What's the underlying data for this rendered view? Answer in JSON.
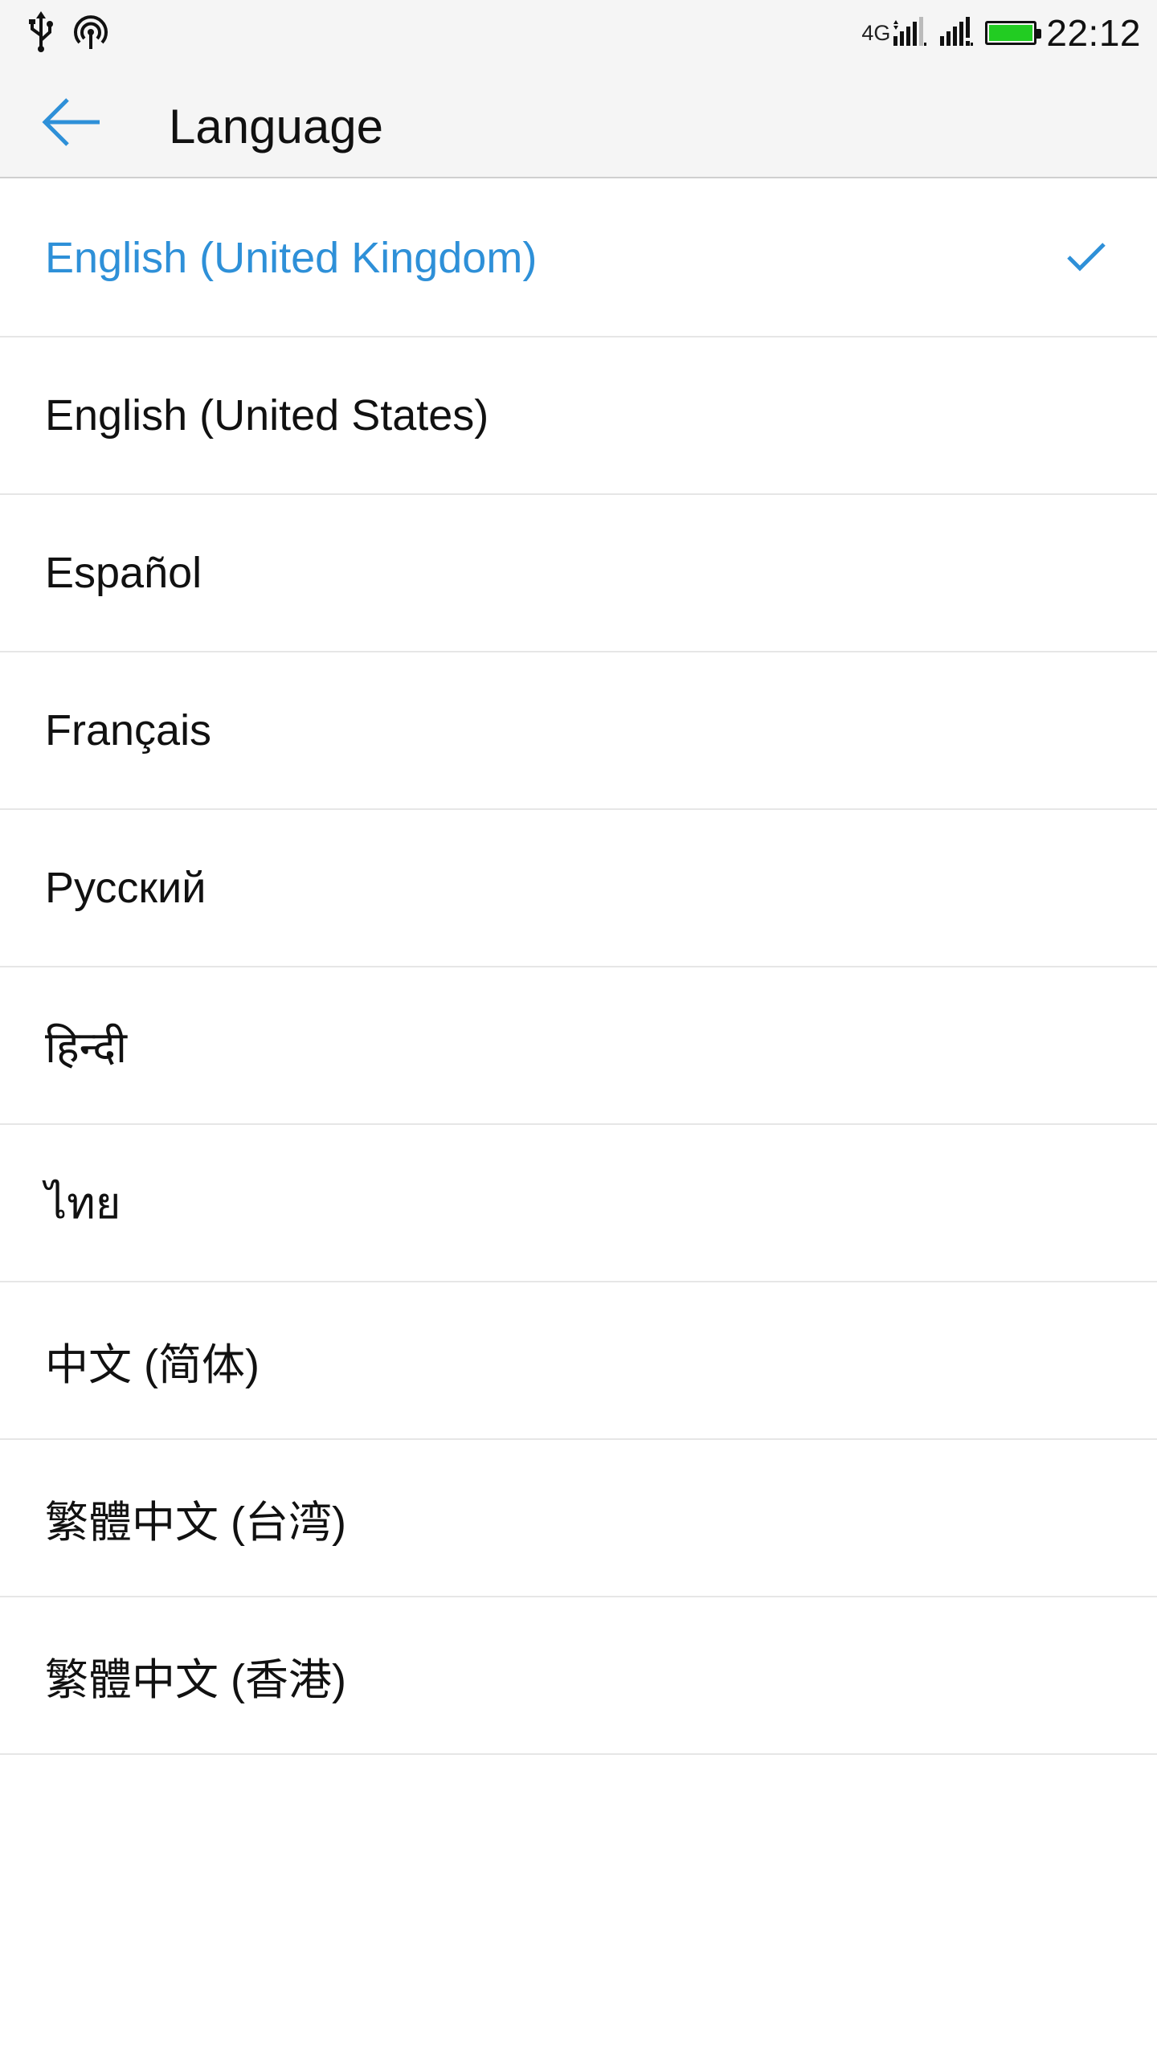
{
  "status_bar": {
    "network_type": "4G",
    "time": "22:12",
    "battery_level": 1.0,
    "icons": [
      "usb-icon",
      "hotspot-icon",
      "signal-sim1-icon",
      "signal-sim2-icon",
      "battery-icon"
    ]
  },
  "header": {
    "title": "Language",
    "back_icon": "arrow-left-icon"
  },
  "colors": {
    "accent": "#2e90d8",
    "battery": "#22cc22",
    "bar_background": "#f5f5f5"
  },
  "languages": [
    {
      "label": "English (United Kingdom)",
      "selected": true
    },
    {
      "label": "English (United States)",
      "selected": false
    },
    {
      "label": "Español",
      "selected": false
    },
    {
      "label": "Français",
      "selected": false
    },
    {
      "label": "Русский",
      "selected": false
    },
    {
      "label": "हिन्दी",
      "selected": false
    },
    {
      "label": "ไทย",
      "selected": false
    },
    {
      "label": "中文 (简体)",
      "selected": false
    },
    {
      "label": "繁體中文 (台湾)",
      "selected": false
    },
    {
      "label": "繁體中文 (香港)",
      "selected": false
    }
  ]
}
